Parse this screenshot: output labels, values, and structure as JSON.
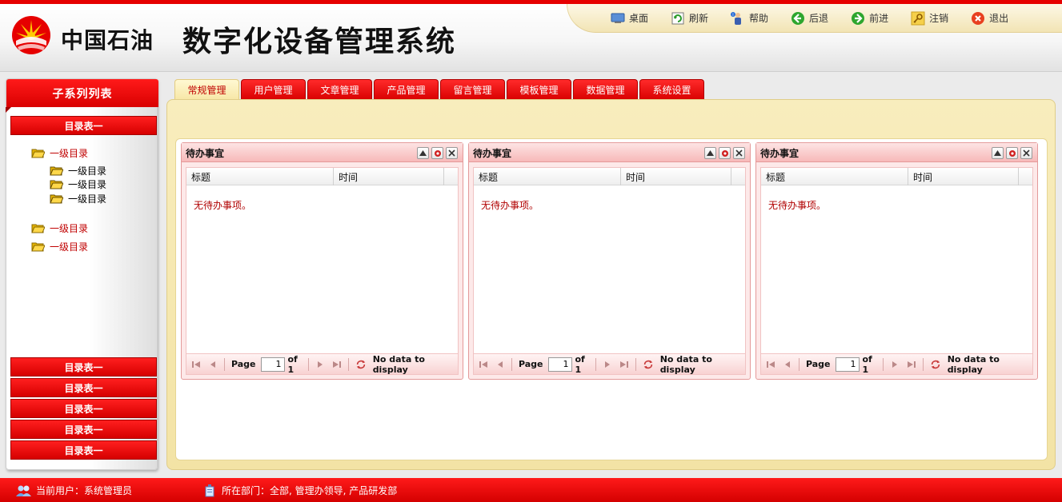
{
  "header": {
    "brand": "中国石油",
    "title": "数字化设备管理系统",
    "toolbar": [
      {
        "label": "桌面",
        "icon": "desktop-icon"
      },
      {
        "label": "刷新",
        "icon": "refresh-icon"
      },
      {
        "label": "帮助",
        "icon": "help-icon"
      },
      {
        "label": "后退",
        "icon": "back-icon"
      },
      {
        "label": "前进",
        "icon": "forward-icon"
      },
      {
        "label": "注销",
        "icon": "logout-key-icon"
      },
      {
        "label": "退出",
        "icon": "exit-icon"
      }
    ]
  },
  "sidebar": {
    "title": "子系列列表",
    "top_category": "目录表一",
    "tree": [
      {
        "label": "一级目录",
        "level": 1
      },
      {
        "label": "一级目录",
        "level": 2
      },
      {
        "label": "一级目录",
        "level": 2
      },
      {
        "label": "一级目录",
        "level": 2
      },
      {
        "label": "一级目录",
        "level": 1
      },
      {
        "label": "一级目录",
        "level": 1
      }
    ],
    "bottom_categories": [
      "目录表一",
      "目录表一",
      "目录表一",
      "目录表一",
      "目录表一"
    ]
  },
  "tabs": [
    {
      "label": "常规管理",
      "active": true
    },
    {
      "label": "用户管理",
      "active": false
    },
    {
      "label": "文章管理",
      "active": false
    },
    {
      "label": "产品管理",
      "active": false
    },
    {
      "label": "留言管理",
      "active": false
    },
    {
      "label": "模板管理",
      "active": false
    },
    {
      "label": "数据管理",
      "active": false
    },
    {
      "label": "系统设置",
      "active": false
    }
  ],
  "panels": [
    {
      "title": "待办事宜",
      "columns": [
        "标题",
        "时间"
      ],
      "empty_text": "无待办事项。",
      "pager": {
        "page_label": "Page",
        "page_value": "1",
        "of_label": "of 1",
        "info": "No data to display"
      }
    },
    {
      "title": "待办事宜",
      "columns": [
        "标题",
        "时间"
      ],
      "empty_text": "无待办事项。",
      "pager": {
        "page_label": "Page",
        "page_value": "1",
        "of_label": "of 1",
        "info": "No data to display"
      }
    },
    {
      "title": "待办事宜",
      "columns": [
        "标题",
        "时间"
      ],
      "empty_text": "无待办事项。",
      "pager": {
        "page_label": "Page",
        "page_value": "1",
        "of_label": "of 1",
        "info": "No data to display"
      }
    }
  ],
  "footer": {
    "user": "当前用户：系统管理员",
    "department": "所在部门：全部, 管理办领导, 产品研发部"
  },
  "colors": {
    "brand_red": "#e60000",
    "tab_active_bg": "#f7e7a6",
    "panel_border": "#e49a9a"
  }
}
